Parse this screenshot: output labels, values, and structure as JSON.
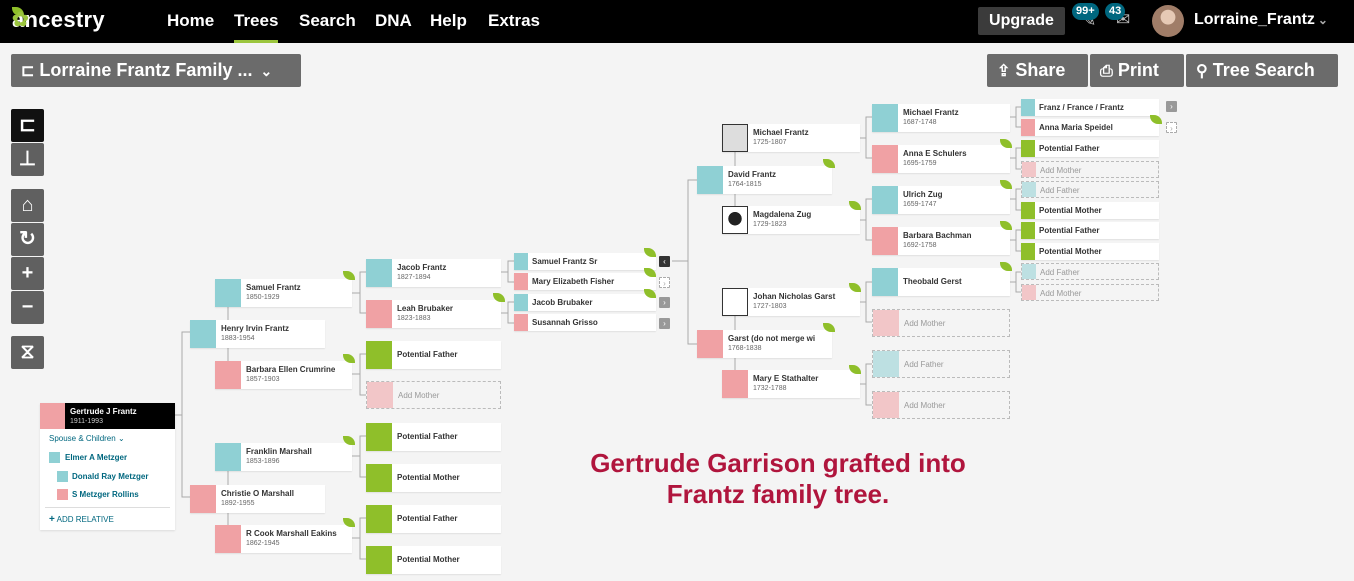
{
  "topbar": {
    "logo_text": "ancestry",
    "nav": [
      "Home",
      "Trees",
      "Search",
      "DNA",
      "Help",
      "Extras"
    ],
    "active_nav": "Trees",
    "upgrade_label": "Upgrade",
    "notification_count": "99+",
    "message_count": "43",
    "username": "Lorraine_Frantz"
  },
  "toolbar": {
    "tree_name": "Lorraine Frantz Family ...",
    "share_label": "Share",
    "print_label": "Print",
    "tree_search_label": "Tree Search"
  },
  "home_person": {
    "name": "Gertrude J Frantz",
    "dates": "1911-1993",
    "spouse_children_label": "Spouse & Children",
    "spouse": "Elmer A Metzger",
    "children": [
      "Donald Ray Metzger",
      "S Metzger Rollins"
    ],
    "add_relative_label": "ADD RELATIVE"
  },
  "people": {
    "samuel": {
      "name": "Samuel Frantz",
      "dates": "1850-1929"
    },
    "henry": {
      "name": "Henry Irvin Frantz",
      "dates": "1883-1954"
    },
    "barbara_ec": {
      "name": "Barbara Ellen Crumrine",
      "dates": "1857-1903"
    },
    "franklin": {
      "name": "Franklin Marshall",
      "dates": "1853-1896"
    },
    "christie": {
      "name": "Christie O Marshall",
      "dates": "1892-1955"
    },
    "rcook": {
      "name": "R Cook Marshall Eakins",
      "dates": "1862-1945"
    },
    "jacob_f": {
      "name": "Jacob Frantz",
      "dates": "1827-1894"
    },
    "leah": {
      "name": "Leah Brubaker",
      "dates": "1823-1883"
    },
    "samuel_sr": {
      "name": "Samuel Frantz Sr"
    },
    "mary_ef": {
      "name": "Mary Elizabeth Fisher"
    },
    "jacob_b": {
      "name": "Jacob Brubaker"
    },
    "susannah": {
      "name": "Susannah Grisso"
    },
    "michael_1725": {
      "name": "Michael Frantz",
      "dates": "1725-1807"
    },
    "david": {
      "name": "David Frantz",
      "dates": "1764-1815"
    },
    "magdalena": {
      "name": "Magdalena Zug",
      "dates": "1729-1823"
    },
    "johan": {
      "name": "Johan Nicholas Garst",
      "dates": "1727-1803"
    },
    "garst": {
      "name": "Garst (do not merge wi",
      "dates": "1768-1838"
    },
    "mary_es": {
      "name": "Mary E Stathalter",
      "dates": "1732-1788"
    },
    "michael_1687": {
      "name": "Michael Frantz",
      "dates": "1687-1748"
    },
    "anna": {
      "name": "Anna E Schulers",
      "dates": "1695-1759"
    },
    "ulrich": {
      "name": "Ulrich Zug",
      "dates": "1659-1747"
    },
    "barbara_b": {
      "name": "Barbara Bachman",
      "dates": "1692-1758"
    },
    "theobald": {
      "name": "Theobald Gerst"
    },
    "franz": {
      "name": "Franz / France / Frantz"
    },
    "anna_maria": {
      "name": "Anna Maria Speidel"
    }
  },
  "placeholders": {
    "potential_father": "Potential Father",
    "potential_mother": "Potential Mother",
    "add_mother": "Add Mother",
    "add_father": "Add Father"
  },
  "caption": "Gertrude Garrison grafted into Frantz family tree.",
  "colors": {
    "male": "#8fd0d4",
    "female": "#f0a1a4",
    "potential": "#8fbf2a",
    "accent": "#9bc53d",
    "caption": "#b0153d"
  }
}
